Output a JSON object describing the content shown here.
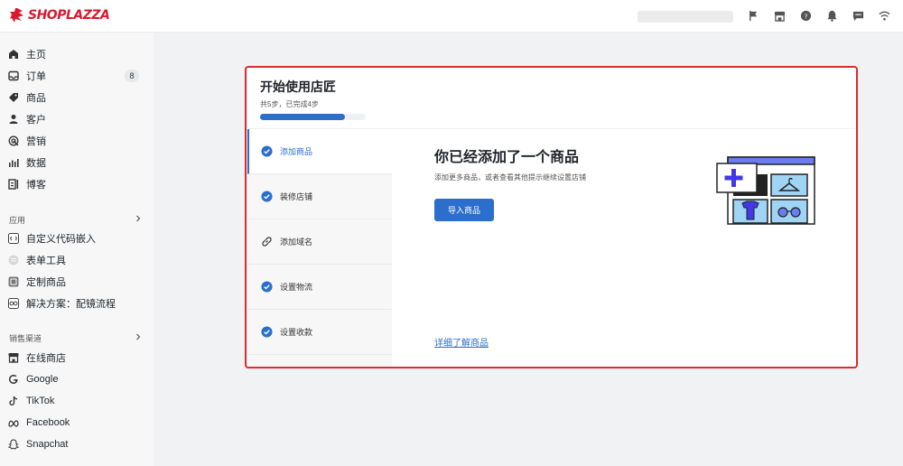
{
  "app": {
    "brand": "SHOPLAZZA",
    "brand_color": "#d9192d",
    "accent_color": "#2c6ecb",
    "top_icons": [
      "flag-icon",
      "store-icon",
      "help-icon",
      "bell-icon",
      "chat-icon",
      "wifi-icon"
    ]
  },
  "sidebar": {
    "main_items": [
      {
        "label": "主页",
        "icon": "home-icon"
      },
      {
        "label": "订单",
        "icon": "inbox-icon",
        "badge": "8"
      },
      {
        "label": "商品",
        "icon": "tag-icon"
      },
      {
        "label": "客户",
        "icon": "person-icon"
      },
      {
        "label": "营销",
        "icon": "target-icon"
      },
      {
        "label": "数据",
        "icon": "bar-chart-icon"
      },
      {
        "label": "博客",
        "icon": "blog-icon"
      }
    ],
    "apps_title": "应用",
    "app_items": [
      {
        "label": "自定义代码嵌入",
        "icon": "code-app-icon"
      },
      {
        "label": "表单工具",
        "icon": "form-app-icon"
      },
      {
        "label": "定制商品",
        "icon": "custom-product-app-icon"
      },
      {
        "label": "解决方案：配镜流程",
        "icon": "glasses-app-icon"
      }
    ],
    "channels_title": "销售渠道",
    "channel_items": [
      {
        "label": "在线商店",
        "icon": "store-icon"
      },
      {
        "label": "Google",
        "icon": "google-icon"
      },
      {
        "label": "TikTok",
        "icon": "tiktok-icon"
      },
      {
        "label": "Facebook",
        "icon": "facebook-icon"
      },
      {
        "label": "Snapchat",
        "icon": "snapchat-icon"
      }
    ]
  },
  "onboarding": {
    "title": "开始使用店匠",
    "progress_text": "共5步，已完成4步",
    "progress_completed": 4,
    "progress_total": 5,
    "steps": [
      {
        "label": "添加商品",
        "done": true,
        "active": true
      },
      {
        "label": "装修店铺",
        "done": true,
        "active": false
      },
      {
        "label": "添加域名",
        "done": false,
        "active": false
      },
      {
        "label": "设置物流",
        "done": true,
        "active": false
      },
      {
        "label": "设置收款",
        "done": true,
        "active": false
      }
    ],
    "panel": {
      "title": "你已经添加了一个商品",
      "description": "添加更多商品，或者查看其他提示继续设置店铺",
      "button_label": "导入商品",
      "link_label": "详细了解商品"
    }
  }
}
